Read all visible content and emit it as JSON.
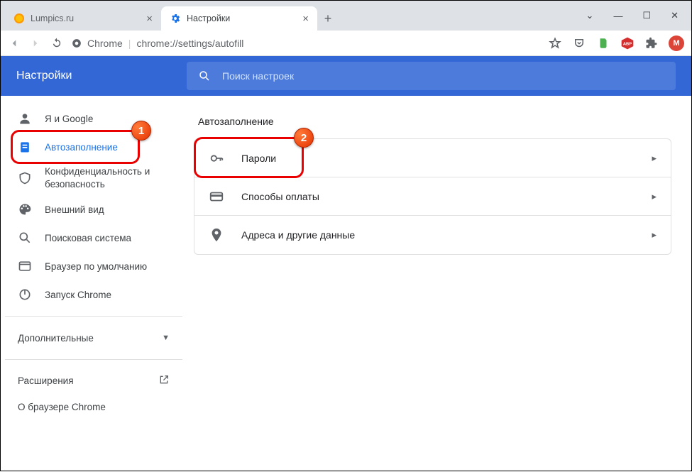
{
  "tabs": [
    {
      "title": "Lumpics.ru"
    },
    {
      "title": "Настройки"
    }
  ],
  "omnibox": {
    "site": "Chrome",
    "url": "chrome://settings/autofill"
  },
  "profile_initial": "M",
  "settings_header": {
    "title": "Настройки",
    "search_placeholder": "Поиск настроек"
  },
  "sidebar": {
    "items": [
      {
        "label": "Я и Google"
      },
      {
        "label": "Автозаполнение"
      },
      {
        "label": "Конфиденциальность и безопасность"
      },
      {
        "label": "Внешний вид"
      },
      {
        "label": "Поисковая система"
      },
      {
        "label": "Браузер по умолчанию"
      },
      {
        "label": "Запуск Chrome"
      }
    ],
    "advanced": "Дополнительные",
    "extensions": "Расширения",
    "about": "О браузере Chrome"
  },
  "autofill": {
    "section_title": "Автозаполнение",
    "rows": [
      {
        "label": "Пароли"
      },
      {
        "label": "Способы оплаты"
      },
      {
        "label": "Адреса и другие данные"
      }
    ]
  },
  "callouts": {
    "one": "1",
    "two": "2"
  }
}
